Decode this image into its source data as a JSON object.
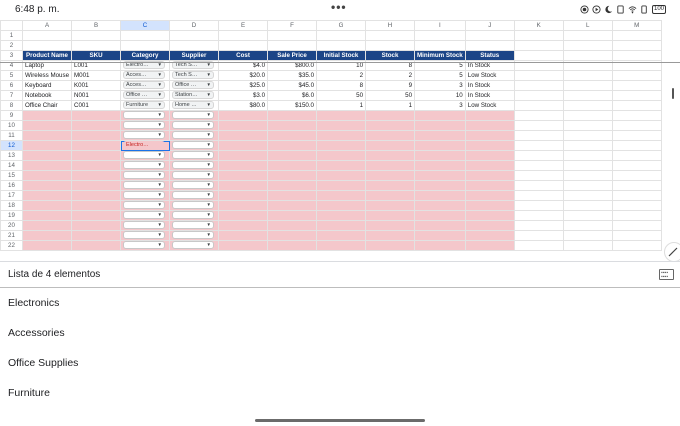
{
  "status_bar": {
    "time": "6:48 p. m.",
    "battery": "100",
    "menu_dots": "•••"
  },
  "columns": [
    "A",
    "B",
    "C",
    "D",
    "E",
    "F",
    "G",
    "H",
    "I",
    "J",
    "K",
    "L",
    "M"
  ],
  "selected_column": "C",
  "selected_row": "12",
  "headers": [
    "Product Name",
    "SKU",
    "Category",
    "Supplier",
    "Cost",
    "Sale Price",
    "Initial Stock",
    "Stock",
    "Minimum Stock",
    "Status"
  ],
  "rows": [
    {
      "num": "4",
      "name": "Laptop",
      "sku": "L001",
      "category": "Electro…",
      "supplier": "Tech S…",
      "cost": "$4.0",
      "price": "$800.0",
      "initial": "10",
      "stock": "8",
      "min": "5",
      "status": "In Stock"
    },
    {
      "num": "5",
      "name": "Wireless Mouse",
      "sku": "M001",
      "category": "Acces…",
      "supplier": "Tech S…",
      "cost": "$20.0",
      "price": "$35.0",
      "initial": "2",
      "stock": "2",
      "min": "5",
      "status": "Low Stock"
    },
    {
      "num": "6",
      "name": "Keyboard",
      "sku": "K001",
      "category": "Acces…",
      "supplier": "Office …",
      "cost": "$25.0",
      "price": "$45.0",
      "initial": "8",
      "stock": "9",
      "min": "3",
      "status": "In Stock"
    },
    {
      "num": "7",
      "name": "Notebook",
      "sku": "N001",
      "category": "Office …",
      "supplier": "Station…",
      "cost": "$3.0",
      "price": "$6.0",
      "initial": "50",
      "stock": "50",
      "min": "10",
      "status": "In Stock"
    },
    {
      "num": "8",
      "name": "Office Chair",
      "sku": "C001",
      "category": "Furniture",
      "supplier": "Home …",
      "cost": "$80.0",
      "price": "$150.0",
      "initial": "1",
      "stock": "1",
      "min": "3",
      "status": "Low Stock"
    }
  ],
  "empty_rows": [
    "9",
    "10",
    "11",
    "12",
    "13",
    "14",
    "15",
    "16",
    "17",
    "18",
    "19",
    "20",
    "21",
    "22"
  ],
  "selected_cell_value": "Electro…",
  "dropdown_panel": {
    "title": "Lista de 4 elementos",
    "options": [
      "Electronics",
      "Accessories",
      "Office Supplies",
      "Furniture"
    ]
  }
}
